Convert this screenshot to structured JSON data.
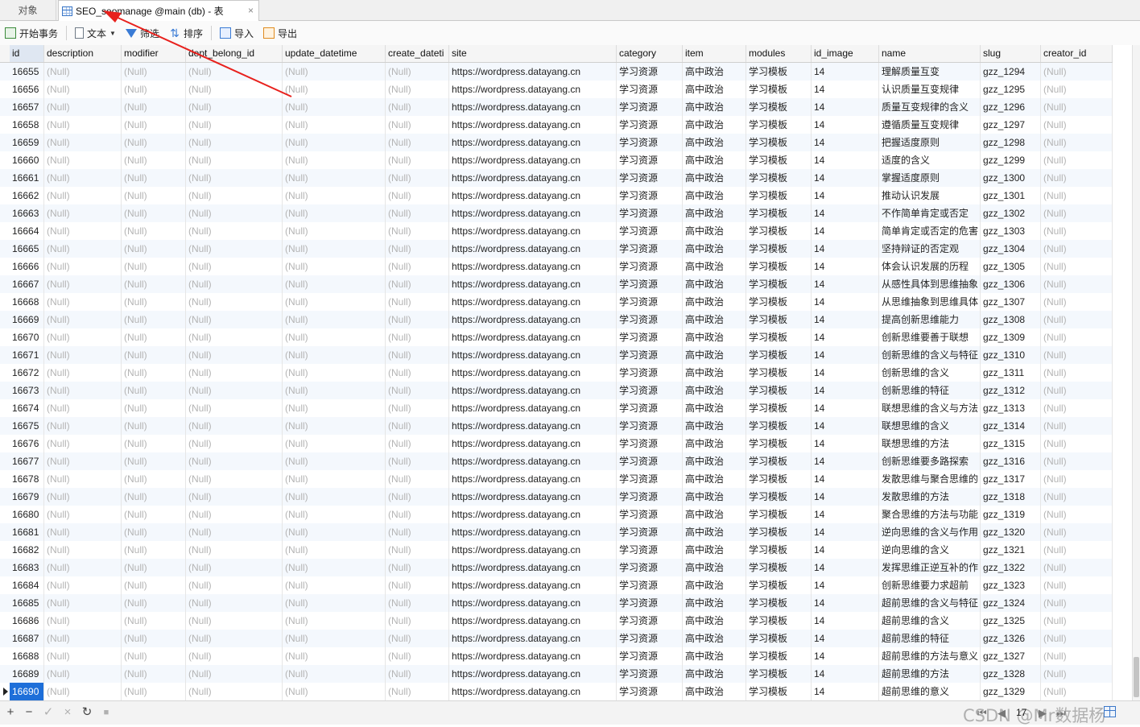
{
  "tabs": {
    "objects_label": "对象",
    "table_label": "SEO_seomanage @main (db) - 表",
    "close_glyph": "×"
  },
  "toolbar": {
    "begin_transaction": "开始事务",
    "text": "文本",
    "filter": "筛选",
    "sort": "排序",
    "import": "导入",
    "export": "导出"
  },
  "columns": [
    "id",
    "description",
    "modifier",
    "dept_belong_id",
    "update_datetime",
    "create_dateti",
    "site",
    "category",
    "item",
    "modules",
    "id_image",
    "name",
    "slug",
    "creator_id"
  ],
  "null_text": "(Null)",
  "rows": [
    {
      "id": "16655",
      "site": "https://wordpress.datayang.cn",
      "category": "学习资源",
      "item": "高中政治",
      "modules": "学习模板",
      "id_image": "14",
      "name": "理解质量互变",
      "slug": "gzz_1294"
    },
    {
      "id": "16656",
      "site": "https://wordpress.datayang.cn",
      "category": "学习资源",
      "item": "高中政治",
      "modules": "学习模板",
      "id_image": "14",
      "name": "认识质量互变规律",
      "slug": "gzz_1295"
    },
    {
      "id": "16657",
      "site": "https://wordpress.datayang.cn",
      "category": "学习资源",
      "item": "高中政治",
      "modules": "学习模板",
      "id_image": "14",
      "name": "质量互变规律的含义",
      "slug": "gzz_1296"
    },
    {
      "id": "16658",
      "site": "https://wordpress.datayang.cn",
      "category": "学习资源",
      "item": "高中政治",
      "modules": "学习模板",
      "id_image": "14",
      "name": "遵循质量互变规律",
      "slug": "gzz_1297"
    },
    {
      "id": "16659",
      "site": "https://wordpress.datayang.cn",
      "category": "学习资源",
      "item": "高中政治",
      "modules": "学习模板",
      "id_image": "14",
      "name": "把握适度原则",
      "slug": "gzz_1298"
    },
    {
      "id": "16660",
      "site": "https://wordpress.datayang.cn",
      "category": "学习资源",
      "item": "高中政治",
      "modules": "学习模板",
      "id_image": "14",
      "name": "适度的含义",
      "slug": "gzz_1299"
    },
    {
      "id": "16661",
      "site": "https://wordpress.datayang.cn",
      "category": "学习资源",
      "item": "高中政治",
      "modules": "学习模板",
      "id_image": "14",
      "name": "掌握适度原则",
      "slug": "gzz_1300"
    },
    {
      "id": "16662",
      "site": "https://wordpress.datayang.cn",
      "category": "学习资源",
      "item": "高中政治",
      "modules": "学习模板",
      "id_image": "14",
      "name": "推动认识发展",
      "slug": "gzz_1301"
    },
    {
      "id": "16663",
      "site": "https://wordpress.datayang.cn",
      "category": "学习资源",
      "item": "高中政治",
      "modules": "学习模板",
      "id_image": "14",
      "name": "不作简单肯定或否定",
      "slug": "gzz_1302"
    },
    {
      "id": "16664",
      "site": "https://wordpress.datayang.cn",
      "category": "学习资源",
      "item": "高中政治",
      "modules": "学习模板",
      "id_image": "14",
      "name": "简单肯定或否定的危害",
      "slug": "gzz_1303"
    },
    {
      "id": "16665",
      "site": "https://wordpress.datayang.cn",
      "category": "学习资源",
      "item": "高中政治",
      "modules": "学习模板",
      "id_image": "14",
      "name": "坚持辩证的否定观",
      "slug": "gzz_1304"
    },
    {
      "id": "16666",
      "site": "https://wordpress.datayang.cn",
      "category": "学习资源",
      "item": "高中政治",
      "modules": "学习模板",
      "id_image": "14",
      "name": "体会认识发展的历程",
      "slug": "gzz_1305"
    },
    {
      "id": "16667",
      "site": "https://wordpress.datayang.cn",
      "category": "学习资源",
      "item": "高中政治",
      "modules": "学习模板",
      "id_image": "14",
      "name": "从感性具体到思维抽象",
      "slug": "gzz_1306"
    },
    {
      "id": "16668",
      "site": "https://wordpress.datayang.cn",
      "category": "学习资源",
      "item": "高中政治",
      "modules": "学习模板",
      "id_image": "14",
      "name": "从思维抽象到思维具体",
      "slug": "gzz_1307"
    },
    {
      "id": "16669",
      "site": "https://wordpress.datayang.cn",
      "category": "学习资源",
      "item": "高中政治",
      "modules": "学习模板",
      "id_image": "14",
      "name": "提高创新思维能力",
      "slug": "gzz_1308"
    },
    {
      "id": "16670",
      "site": "https://wordpress.datayang.cn",
      "category": "学习资源",
      "item": "高中政治",
      "modules": "学习模板",
      "id_image": "14",
      "name": "创新思维要善于联想",
      "slug": "gzz_1309"
    },
    {
      "id": "16671",
      "site": "https://wordpress.datayang.cn",
      "category": "学习资源",
      "item": "高中政治",
      "modules": "学习模板",
      "id_image": "14",
      "name": "创新思维的含义与特征",
      "slug": "gzz_1310"
    },
    {
      "id": "16672",
      "site": "https://wordpress.datayang.cn",
      "category": "学习资源",
      "item": "高中政治",
      "modules": "学习模板",
      "id_image": "14",
      "name": "创新思维的含义",
      "slug": "gzz_1311"
    },
    {
      "id": "16673",
      "site": "https://wordpress.datayang.cn",
      "category": "学习资源",
      "item": "高中政治",
      "modules": "学习模板",
      "id_image": "14",
      "name": "创新思维的特征",
      "slug": "gzz_1312"
    },
    {
      "id": "16674",
      "site": "https://wordpress.datayang.cn",
      "category": "学习资源",
      "item": "高中政治",
      "modules": "学习模板",
      "id_image": "14",
      "name": "联想思维的含义与方法",
      "slug": "gzz_1313"
    },
    {
      "id": "16675",
      "site": "https://wordpress.datayang.cn",
      "category": "学习资源",
      "item": "高中政治",
      "modules": "学习模板",
      "id_image": "14",
      "name": "联想思维的含义",
      "slug": "gzz_1314"
    },
    {
      "id": "16676",
      "site": "https://wordpress.datayang.cn",
      "category": "学习资源",
      "item": "高中政治",
      "modules": "学习模板",
      "id_image": "14",
      "name": "联想思维的方法",
      "slug": "gzz_1315"
    },
    {
      "id": "16677",
      "site": "https://wordpress.datayang.cn",
      "category": "学习资源",
      "item": "高中政治",
      "modules": "学习模板",
      "id_image": "14",
      "name": "创新思维要多路探索",
      "slug": "gzz_1316"
    },
    {
      "id": "16678",
      "site": "https://wordpress.datayang.cn",
      "category": "学习资源",
      "item": "高中政治",
      "modules": "学习模板",
      "id_image": "14",
      "name": "发散思维与聚合思维的",
      "slug": "gzz_1317"
    },
    {
      "id": "16679",
      "site": "https://wordpress.datayang.cn",
      "category": "学习资源",
      "item": "高中政治",
      "modules": "学习模板",
      "id_image": "14",
      "name": "发散思维的方法",
      "slug": "gzz_1318"
    },
    {
      "id": "16680",
      "site": "https://wordpress.datayang.cn",
      "category": "学习资源",
      "item": "高中政治",
      "modules": "学习模板",
      "id_image": "14",
      "name": "聚合思维的方法与功能",
      "slug": "gzz_1319"
    },
    {
      "id": "16681",
      "site": "https://wordpress.datayang.cn",
      "category": "学习资源",
      "item": "高中政治",
      "modules": "学习模板",
      "id_image": "14",
      "name": "逆向思维的含义与作用",
      "slug": "gzz_1320"
    },
    {
      "id": "16682",
      "site": "https://wordpress.datayang.cn",
      "category": "学习资源",
      "item": "高中政治",
      "modules": "学习模板",
      "id_image": "14",
      "name": "逆向思维的含义",
      "slug": "gzz_1321"
    },
    {
      "id": "16683",
      "site": "https://wordpress.datayang.cn",
      "category": "学习资源",
      "item": "高中政治",
      "modules": "学习模板",
      "id_image": "14",
      "name": "发挥思维正逆互补的作",
      "slug": "gzz_1322"
    },
    {
      "id": "16684",
      "site": "https://wordpress.datayang.cn",
      "category": "学习资源",
      "item": "高中政治",
      "modules": "学习模板",
      "id_image": "14",
      "name": "创新思维要力求超前",
      "slug": "gzz_1323"
    },
    {
      "id": "16685",
      "site": "https://wordpress.datayang.cn",
      "category": "学习资源",
      "item": "高中政治",
      "modules": "学习模板",
      "id_image": "14",
      "name": "超前思维的含义与特征",
      "slug": "gzz_1324"
    },
    {
      "id": "16686",
      "site": "https://wordpress.datayang.cn",
      "category": "学习资源",
      "item": "高中政治",
      "modules": "学习模板",
      "id_image": "14",
      "name": "超前思维的含义",
      "slug": "gzz_1325"
    },
    {
      "id": "16687",
      "site": "https://wordpress.datayang.cn",
      "category": "学习资源",
      "item": "高中政治",
      "modules": "学习模板",
      "id_image": "14",
      "name": "超前思维的特征",
      "slug": "gzz_1326"
    },
    {
      "id": "16688",
      "site": "https://wordpress.datayang.cn",
      "category": "学习资源",
      "item": "高中政治",
      "modules": "学习模板",
      "id_image": "14",
      "name": "超前思维的方法与意义",
      "slug": "gzz_1327"
    },
    {
      "id": "16689",
      "site": "https://wordpress.datayang.cn",
      "category": "学习资源",
      "item": "高中政治",
      "modules": "学习模板",
      "id_image": "14",
      "name": "超前思维的方法",
      "slug": "gzz_1328"
    },
    {
      "id": "16690",
      "site": "https://wordpress.datayang.cn",
      "category": "学习资源",
      "item": "高中政治",
      "modules": "学习模板",
      "id_image": "14",
      "name": "超前思维的意义",
      "slug": "gzz_1329"
    }
  ],
  "current_row_id": "16690",
  "bottombar": {
    "add": "+",
    "remove": "−",
    "apply": "✓",
    "cancel": "×",
    "refresh": "↻",
    "stop": "■",
    "first": "⏮",
    "prev": "◀",
    "page": "17",
    "next": "▶",
    "last": "⏭",
    "watermark": "CSDN @Mr数据杨"
  },
  "colors": {
    "accent": "#1e6fd9",
    "null_text": "#b4b4b4",
    "annotation_arrow": "#e8211d"
  }
}
